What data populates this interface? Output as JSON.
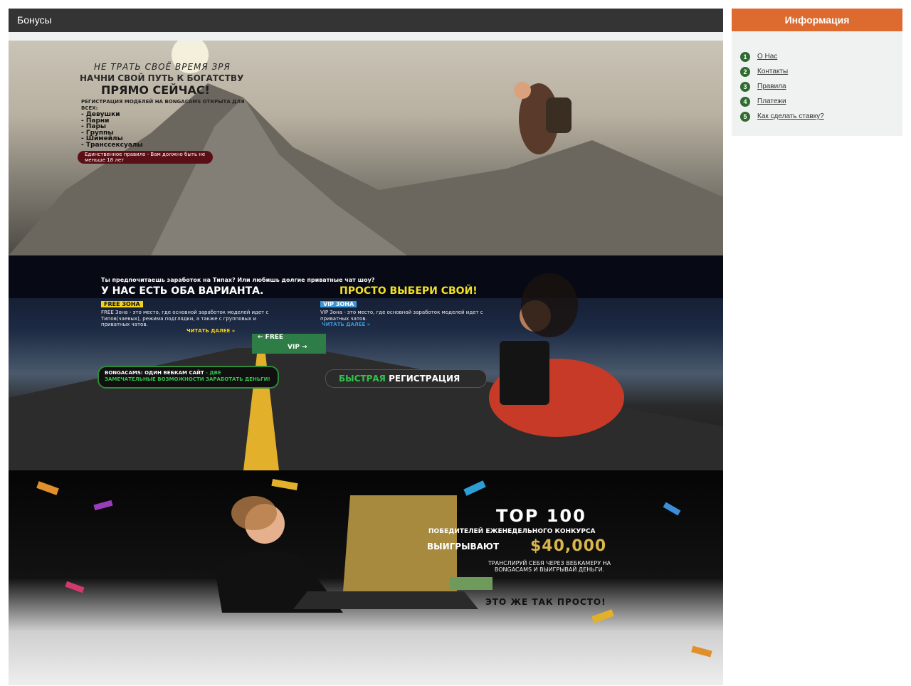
{
  "header": {
    "title": "Бонусы"
  },
  "sidebar": {
    "title": "Информация",
    "items": [
      {
        "num": "1",
        "label": "О Нас"
      },
      {
        "num": "2",
        "label": "Контакты"
      },
      {
        "num": "3",
        "label": "Правила"
      },
      {
        "num": "4",
        "label": "Платежи"
      },
      {
        "num": "5",
        "label": "Как сделать ставку?"
      }
    ]
  },
  "banner1": {
    "line1": "НЕ ТРАТЬ СВОЁ ВРЕМЯ ЗРЯ",
    "line2": "НАЧНИ СВОЙ ПУТЬ К БОГАТСТВУ",
    "line3": "ПРЯМО СЕЙЧАС!",
    "intro": "РЕГИСТРАЦИЯ МОДЕЛЕЙ НА BONGACAMS ОТКРЫТА ДЛЯ ВСЕХ:",
    "list": [
      "- Девушки",
      "- Парни",
      "- Пары",
      "- Группы",
      "- Шимейлы",
      "- Транссексуалы"
    ],
    "rule": "Единственное правило - Вам должно быть не меньше 18 лет"
  },
  "banner2": {
    "question": "Ты предпочитаешь заработок на Типах? Или любишь долгие приватные чат шоу?",
    "headline_a": "У НАС ЕСТЬ ОБА ВАРИАНТА.",
    "headline_b": "ПРОСТО ВЫБЕРИ СВОЙ!",
    "free_label": "FREE ЗОНА",
    "free_text": "FREE Зона - это место, где основной заработок моделей идет с Типов(чаевых), режима подглядки, а также с групповых и приватных чатов.",
    "free_more": "ЧИТАТЬ ДАЛЕЕ »",
    "vip_label": "VIP ЗОНА",
    "vip_text": "VIP Зона - это место, где основной заработок моделей идет с приватных чатов.",
    "vip_more": "ЧИТАТЬ ДАЛЕЕ »",
    "sign_free": "← FREE",
    "sign_vip": "VIP →",
    "bonga_a": "BONGACAMS: ОДИН ВЕБКАМ САЙТ",
    "bonga_b": "- ДВЕ ЗАМЕЧАТЕЛЬНЫЕ ВОЗМОЖНОСТИ ЗАРАБОТАТЬ ДЕНЬГИ!",
    "reg_a": "БЫСТРАЯ",
    "reg_b": "РЕГИСТРАЦИЯ"
  },
  "banner3": {
    "top": "TOP 100",
    "sub": "ПОБЕДИТЕЛЕЙ ЕЖЕНЕДЕЛЬНОГО КОНКУРСА",
    "win": "ВЫИГРЫВАЮТ",
    "amount": "$40,000",
    "desc": "ТРАНСЛИРУЙ СЕБЯ ЧЕРЕЗ ВЕБКАМЕРУ НА BONGACAMS И ВЫИГРЫВАЙ ДЕНЬГИ.",
    "easy": "ЭТО ЖЕ ТАК ПРОСТО!"
  }
}
